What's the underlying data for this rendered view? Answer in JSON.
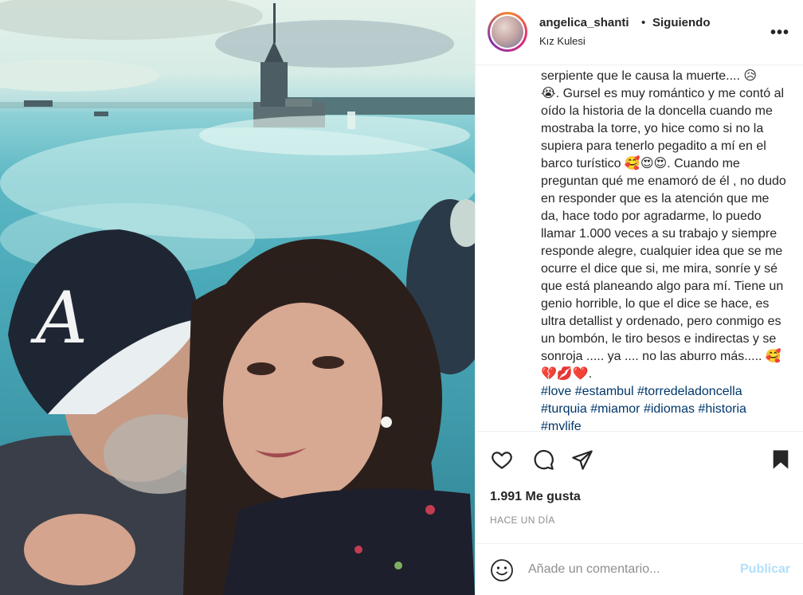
{
  "post": {
    "username": "angelica_shanti",
    "separator": "•",
    "follow_status": "Siguiendo",
    "location": "Kız Kulesi",
    "more_label": "•••",
    "caption_text": "serpiente que le causa la muerte.... 😥\n😭. Gursel es muy romántico y me contó al oído la historia de la doncella cuando me mostraba la torre, yo hice como si no la supiera para tenerlo pegadito a mí en el barco turístico 🥰😍😍. Cuando me preguntan qué me enamoró de él , no dudo en responder que es la atención que me da, hace todo por agradarme, lo puedo llamar 1.000 veces a su trabajo y siempre responde alegre, cualquier idea que se me ocurre el dice que si, me mira, sonríe y sé que está planeando algo para mí. Tiene un genio horrible, lo que el dice se hace, es ultra detallist y ordenado, pero conmigo es un bombón, le tiro besos e indirectas y se sonroja ..... ya .... no las aburro más..... 🥰💔💋❤️.",
    "hashtags": "#love #estambul #torredeladoncella #turquia #miamor #idiomas #historia #mylife",
    "likes": "1.991 Me gusta",
    "time": "HACE UN DÍA"
  },
  "comment": {
    "placeholder": "Añade un comentario...",
    "publish_label": "Publicar"
  },
  "icons": [
    "heart-icon",
    "comment-icon",
    "share-icon",
    "bookmark-icon",
    "emoji-icon",
    "more-icon"
  ],
  "colors": {
    "link": "#00376b",
    "publish_disabled": "#b2dffc",
    "secondary_text": "#8e8e8e"
  }
}
